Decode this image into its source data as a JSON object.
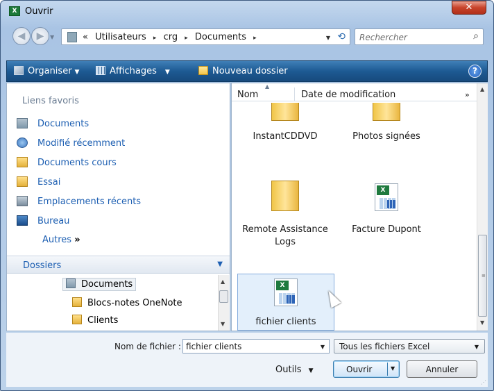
{
  "window": {
    "title": "Ouvrir",
    "close_glyph": "✕"
  },
  "nav": {
    "back_glyph": "◀",
    "forward_glyph": "▶"
  },
  "address": {
    "crumbs": [
      "«",
      "Utilisateurs",
      "crg",
      "Documents"
    ],
    "separator": "▸"
  },
  "search": {
    "placeholder": "Rechercher"
  },
  "toolbar": {
    "organize": "Organiser",
    "views": "Affichages",
    "new_folder": "Nouveau dossier",
    "help": "?"
  },
  "favorites": {
    "heading": "Liens favoris",
    "items": [
      {
        "label": "Documents",
        "icon": "documents-icon"
      },
      {
        "label": "Modifié récemment",
        "icon": "recent-icon"
      },
      {
        "label": "Documents cours",
        "icon": "folder-icon"
      },
      {
        "label": "Essai",
        "icon": "folder-icon"
      },
      {
        "label": "Emplacements récents",
        "icon": "recent-places-icon"
      },
      {
        "label": "Bureau",
        "icon": "desktop-icon"
      }
    ],
    "more": "Autres",
    "more_glyph": "»"
  },
  "folders": {
    "label": "Dossiers",
    "tree": [
      {
        "label": "Documents",
        "icon": "documents-icon",
        "selected": true
      },
      {
        "label": "Blocs-notes OneNote",
        "icon": "folder-icon",
        "selected": false
      },
      {
        "label": "Clients",
        "icon": "folder-icon",
        "selected": false
      }
    ]
  },
  "columns": {
    "name": "Nom",
    "date": "Date de modification",
    "more": "»"
  },
  "files": [
    {
      "label": "InstantCDDVD",
      "type": "folder",
      "selected": false
    },
    {
      "label": "Photos signées",
      "type": "folder",
      "selected": false
    },
    {
      "label": "Remote Assistance Logs",
      "type": "folder",
      "selected": false
    },
    {
      "label": "Facture Dupont",
      "type": "excel",
      "selected": false
    },
    {
      "label": "fichier clients",
      "type": "excel",
      "selected": true
    }
  ],
  "bottom": {
    "filename_label": "Nom de fichier :",
    "filename_value": "fichier clients",
    "filetype_value": "Tous les fichiers Excel",
    "tools_label": "Outils",
    "open_label": "Ouvrir",
    "cancel_label": "Annuler"
  },
  "colors": {
    "toolbar_bg": "#1d5a93",
    "link": "#1d5fb2",
    "selection": "#e3effb"
  }
}
